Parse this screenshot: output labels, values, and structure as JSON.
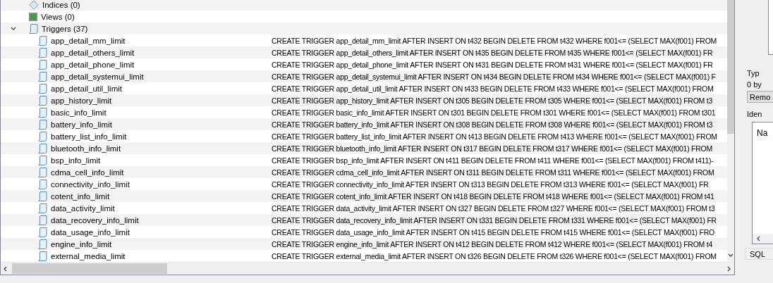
{
  "tree": [
    {
      "label": "Indices (0)",
      "kind": "index"
    },
    {
      "label": "Views (0)",
      "kind": "view"
    },
    {
      "label": "Triggers (37)",
      "kind": "trigger",
      "expanded": true,
      "children": [
        {
          "name": "app_detail_mm_limit",
          "sql": "CREATE TRIGGER app_detail_mm_limit AFTER INSERT ON t432 BEGIN DELETE FROM t432 WHERE f001<= (SELECT MAX(f001) FROM"
        },
        {
          "name": "app_detail_others_limit",
          "sql": "CREATE TRIGGER app_detail_others_limit AFTER INSERT ON t435 BEGIN DELETE FROM t435 WHERE f001<= (SELECT MAX(f001) FR"
        },
        {
          "name": "app_detail_phone_limit",
          "sql": "CREATE TRIGGER app_detail_phone_limit AFTER INSERT ON t431 BEGIN DELETE FROM t431 WHERE f001<= (SELECT MAX(f001) FR"
        },
        {
          "name": "app_detail_systemui_limit",
          "sql": "CREATE TRIGGER app_detail_systemui_limit AFTER INSERT ON t434 BEGIN DELETE FROM t434 WHERE f001<= (SELECT MAX(f001) F"
        },
        {
          "name": "app_detail_util_limit",
          "sql": "CREATE TRIGGER app_detail_util_limit AFTER INSERT ON t433 BEGIN DELETE FROM t433 WHERE f001<= (SELECT MAX(f001) FROM"
        },
        {
          "name": "app_history_limit",
          "sql": "CREATE TRIGGER app_history_limit AFTER INSERT ON t305 BEGIN DELETE FROM t305 WHERE f001<= (SELECT MAX(f001) FROM t3"
        },
        {
          "name": "basic_info_limit",
          "sql": "CREATE TRIGGER basic_info_limit AFTER INSERT ON t301 BEGIN DELETE FROM t301 WHERE f001<= (SELECT MAX(f001) FROM t301"
        },
        {
          "name": "battery_info_limit",
          "sql": "CREATE TRIGGER battery_info_limit AFTER INSERT ON t308 BEGIN DELETE FROM t308 WHERE f001<= (SELECT MAX(f001) FROM t3"
        },
        {
          "name": "battery_list_info_limit",
          "sql": "CREATE TRIGGER battery_list_info_limit AFTER INSERT ON t413 BEGIN DELETE FROM t413 WHERE f001<= (SELECT MAX(f001) FROM"
        },
        {
          "name": "bluetooth_info_limit",
          "sql": "CREATE TRIGGER bluetooth_info_limit AFTER INSERT ON t317 BEGIN DELETE FROM t317 WHERE f001<= (SELECT MAX(f001) FROM"
        },
        {
          "name": "bsp_info_limit",
          "sql": "CREATE TRIGGER bsp_info_limit AFTER INSERT ON t411 BEGIN DELETE FROM t411 WHERE f001<= (SELECT MAX(f001) FROM t411)-"
        },
        {
          "name": "cdma_cell_info_limit",
          "sql": "CREATE TRIGGER cdma_cell_info_limit AFTER INSERT ON t311 BEGIN DELETE FROM t311 WHERE f001<= (SELECT MAX(f001) FROM"
        },
        {
          "name": "connectivity_info_limit",
          "sql": "CREATE TRIGGER connectivity_info_limit AFTER INSERT ON t313 BEGIN DELETE FROM t313 WHERE f001<= (SELECT MAX(f001) FR"
        },
        {
          "name": "cotent_info_limit",
          "sql": "CREATE TRIGGER cotent_info_limit AFTER INSERT ON t418 BEGIN DELETE FROM t418 WHERE f001<= (SELECT MAX(f001) FROM t41"
        },
        {
          "name": "data_activity_limit",
          "sql": "CREATE TRIGGER data_activity_limit AFTER INSERT ON t327 BEGIN DELETE FROM t327 WHERE f001<= (SELECT MAX(f001) FROM t3"
        },
        {
          "name": "data_recovery_info_limit",
          "sql": "CREATE TRIGGER data_recovery_info_limit AFTER INSERT ON t331 BEGIN DELETE FROM t331 WHERE f001<= (SELECT MAX(f001) FR"
        },
        {
          "name": "data_usage_info_limit",
          "sql": "CREATE TRIGGER data_usage_info_limit AFTER INSERT ON t415 BEGIN DELETE FROM t415 WHERE f001<= (SELECT MAX(f001) FRO"
        },
        {
          "name": "engine_info_limit",
          "sql": "CREATE TRIGGER engine_info_limit AFTER INSERT ON t412 BEGIN DELETE FROM t412 WHERE f001<= (SELECT MAX(f001) FROM t4"
        },
        {
          "name": "external_media_limit",
          "sql": "CREATE TRIGGER external_media_limit AFTER INSERT ON t326 BEGIN DELETE FROM t326 WHERE f001<= (SELECT MAX(f001) FROM"
        }
      ]
    }
  ],
  "side_panel": {
    "type_label": "Typ",
    "size_text": "0 by",
    "remove_button": "Remo",
    "identity_label": "Iden",
    "list_text": "Na",
    "tab": "SQL"
  }
}
